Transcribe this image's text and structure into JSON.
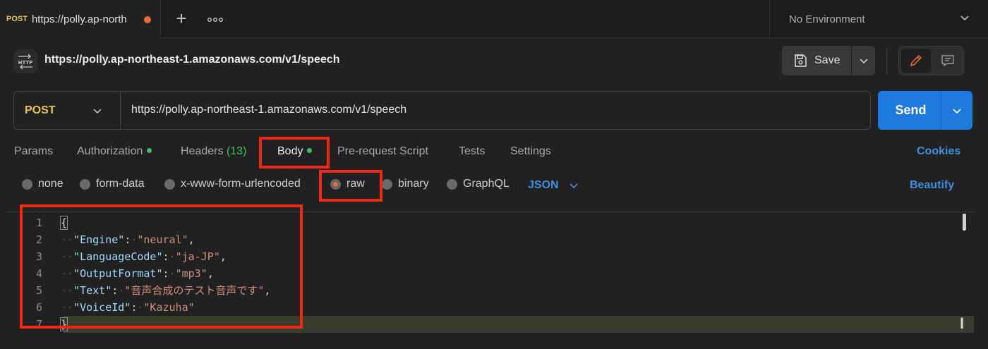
{
  "tabbar": {
    "active_tab": {
      "method": "POST",
      "name": "https://polly.ap-north",
      "unsaved": true
    },
    "new_tab_icon": "plus-icon",
    "more_icon": "ellipsis-icon",
    "environment": "No Environment"
  },
  "request": {
    "title": "https://polly.ap-northeast-1.amazonaws.com/v1/speech",
    "save_label": "Save",
    "method": "POST",
    "url": "https://polly.ap-northeast-1.amazonaws.com/v1/speech",
    "send_label": "Send"
  },
  "subtabs": {
    "params": "Params",
    "authorization": "Authorization",
    "headers": "Headers",
    "headers_count": "(13)",
    "body": "Body",
    "prerequest": "Pre-request Script",
    "tests": "Tests",
    "settings": "Settings",
    "cookies": "Cookies"
  },
  "body_types": {
    "none": "none",
    "form_data": "form-data",
    "urlencoded": "x-www-form-urlencoded",
    "raw": "raw",
    "binary": "binary",
    "graphql": "GraphQL",
    "format": "JSON",
    "beautify": "Beautify",
    "selected": "raw"
  },
  "editor": {
    "lines": [
      {
        "n": "1",
        "key": "",
        "value": "",
        "text": "{"
      },
      {
        "n": "2",
        "key": "\"Engine\"",
        "value": "\"neural\""
      },
      {
        "n": "3",
        "key": "\"LanguageCode\"",
        "value": "\"ja-JP\""
      },
      {
        "n": "4",
        "key": "\"OutputFormat\"",
        "value": "\"mp3\""
      },
      {
        "n": "5",
        "key": "\"Text\"",
        "value": "\"音声合成のテスト音声です\""
      },
      {
        "n": "6",
        "key": "\"VoiceId\"",
        "value": "\"Kazuha\""
      },
      {
        "n": "7",
        "key": "",
        "value": "",
        "text": "}"
      }
    ]
  },
  "colors": {
    "accent_blue": "#1f7ae0",
    "method_post": "#e8c35a",
    "unsaved_dot": "#f26b3a",
    "green_dot": "#3fbf6a",
    "annotation_red": "#ef2a14"
  }
}
